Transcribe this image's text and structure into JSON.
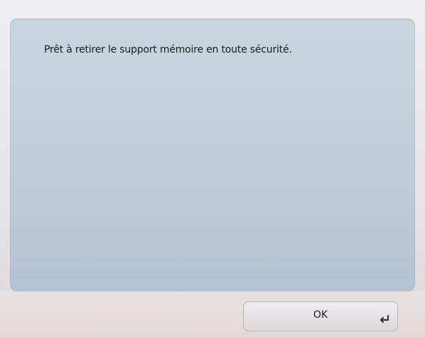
{
  "dialog": {
    "message": "Prêt à retirer le support mémoire en toute sécurité."
  },
  "buttons": {
    "ok_label": "OK"
  },
  "icons": {
    "enter": "enter-return-icon"
  },
  "colors": {
    "panel": "#c4d1dd",
    "text": "#1b1b1d",
    "button": "#e6e3e5"
  }
}
